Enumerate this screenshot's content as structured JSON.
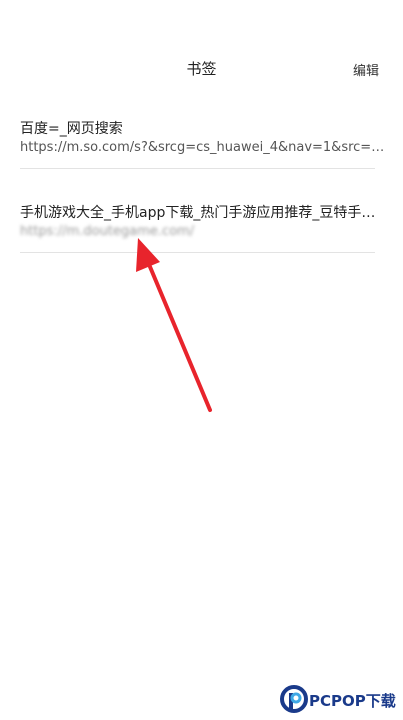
{
  "header": {
    "title": "书签",
    "edit_label": "编辑"
  },
  "bookmarks": [
    {
      "title": "百度=_网页搜索",
      "url": "https://m.so.com/s?&srcg=cs_huawei_4&nav=1&src=home"
    },
    {
      "title": "手机游戏大全_手机app下载_热门手游应用推荐_豆特手游网",
      "url": "https://m.doutegame.com/"
    }
  ],
  "watermark": {
    "text": "PCPOP下载"
  },
  "colors": {
    "arrow": "#e8242c",
    "watermark": "#1a3a8a"
  }
}
